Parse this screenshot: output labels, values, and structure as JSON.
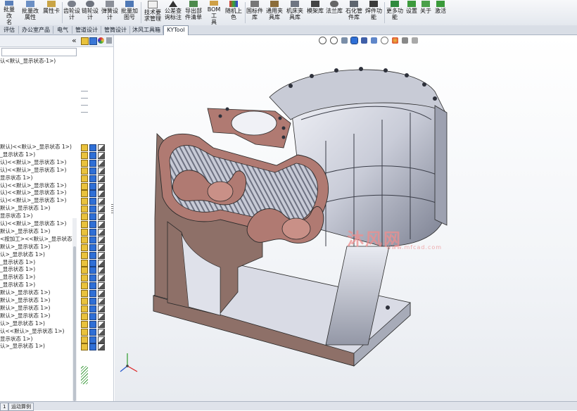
{
  "ribbon": {
    "buttons": [
      {
        "label": "批量改\n名"
      },
      {
        "label": "批量改\n属性"
      },
      {
        "label": "属性卡"
      },
      {
        "label": "齿轮设\n计"
      },
      {
        "label": "链轮设\n计"
      },
      {
        "label": "弹簧设\n计"
      },
      {
        "label": "批量加\n图号"
      },
      {
        "label": "技术要\n求管理"
      },
      {
        "label": "公差查\n询标注"
      },
      {
        "label": "导出部\n件清单"
      },
      {
        "label": "BOM工\n具"
      },
      {
        "label": "随机上\n色"
      },
      {
        "label": "国标件\n库"
      },
      {
        "label": "通用夹\n具库"
      },
      {
        "label": "机床夹\n具库"
      },
      {
        "label": "模架库"
      },
      {
        "label": "法兰库"
      },
      {
        "label": "石化管\n件库"
      },
      {
        "label": "焊件功\n能"
      },
      {
        "label": "更多功\n能"
      },
      {
        "label": "设置"
      },
      {
        "label": "关于"
      },
      {
        "label": "激活"
      }
    ]
  },
  "tabs": [
    {
      "label": "评估"
    },
    {
      "label": "办公室产品"
    },
    {
      "label": "电气"
    },
    {
      "label": "管道设计"
    },
    {
      "label": "管筒设计"
    },
    {
      "label": "沐风工具箱"
    },
    {
      "label": "KYTool",
      "active": true
    }
  ],
  "feature_tree": {
    "collapse_glyph": "«",
    "root": "认<默认_显示状态-1>)",
    "rows": [
      "默认)<<默认>_显示状态 1>)",
      "_显示状态 1>)",
      "认)<<默认>_显示状态 1>)",
      "认)<<默认>_显示状态 1>)",
      "显示状态 1>)",
      "认)<<默认>_显示状态 1>)",
      "认)<<默认>_显示状态 1>)",
      "认)<<默认>_显示状态 1>)",
      "默认>_显示状态 1>)",
      "显示状态 1>)",
      "认)<<默认>_显示状态 1>)",
      "默认>_显示状态 1>)",
      "<按加工><<默认>_显示状态",
      "默认>_显示状态 1>)",
      "认>_显示状态 1>)",
      "_显示状态 1>)",
      "_显示状态 1>)",
      "_显示状态 1>)",
      "_显示状态 1>)",
      "默认>_显示状态 1>)",
      "默认>_显示状态 1>)",
      "默认>_显示状态 1>)",
      "默认>_显示状态 1>)",
      "认>_显示状态 1>)",
      "认<<默认>_显示状态 1>)",
      "显示状态 1>)",
      "认>_显示状态 1>)"
    ]
  },
  "graphics": {
    "watermark": "沐风网",
    "watermark_url": "www.mfcad.com"
  },
  "status_tabs": [
    {
      "label": "1"
    },
    {
      "label": "运动算例"
    }
  ],
  "colors": {
    "section_face": "#b07a72",
    "metal_light": "#e4e6ef",
    "metal_dark": "#5a5f6e",
    "accent_blue": "#2f6fd6"
  }
}
